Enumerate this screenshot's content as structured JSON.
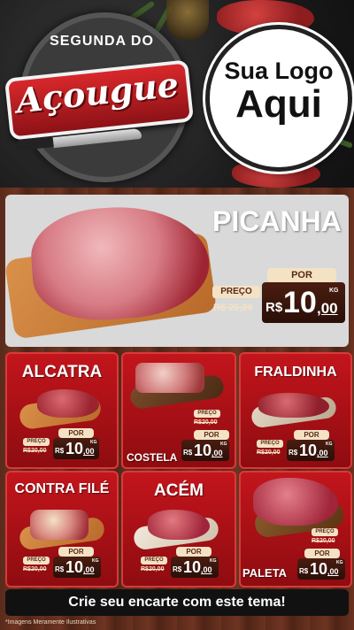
{
  "logo": {
    "top_text": "SEGUNDA DO",
    "word": "Açougue"
  },
  "brand": {
    "line1": "Sua Logo",
    "line2": "Aqui"
  },
  "featured": {
    "name": "PICANHA",
    "por": "POR",
    "preco": "PREÇO",
    "old_price": "R$ 20,00",
    "currency": "R$",
    "int": "10",
    "cents": ",00",
    "unit": "KG"
  },
  "products": [
    {
      "name": "ALCATRA",
      "por": "POR",
      "preco": "PREÇO",
      "old_price": "R$20,00",
      "currency": "R$",
      "int": "10",
      "cents": ",00",
      "unit": "KG"
    },
    {
      "name": "COSTELA",
      "por": "POR",
      "preco": "PREÇO",
      "old_price": "R$20,00",
      "currency": "R$",
      "int": "10",
      "cents": ",00",
      "unit": "KG"
    },
    {
      "name": "FRALDINHA",
      "por": "POR",
      "preco": "PREÇO",
      "old_price": "R$20,00",
      "currency": "R$",
      "int": "10",
      "cents": ",00",
      "unit": "KG"
    },
    {
      "name": "CONTRA FILÉ",
      "por": "POR",
      "preco": "PREÇO",
      "old_price": "R$20,00",
      "currency": "R$",
      "int": "10",
      "cents": ",00",
      "unit": "KG"
    },
    {
      "name": "ACÉM",
      "por": "POR",
      "preco": "PREÇO",
      "old_price": "R$20,00",
      "currency": "R$",
      "int": "10",
      "cents": ",00",
      "unit": "KG"
    },
    {
      "name": "PALETA",
      "por": "POR",
      "preco": "PREÇO",
      "old_price": "R$20,00",
      "currency": "R$",
      "int": "10",
      "cents": ",00",
      "unit": "KG"
    }
  ],
  "cta": "Crie seu encarte com este tema!",
  "disclaimer": "*Imagens Meramente Ilustrativas",
  "colors": {
    "red": "#c3151c",
    "dark": "#111111",
    "cream": "#f4e2c5",
    "wood": "#5a2a1a"
  }
}
